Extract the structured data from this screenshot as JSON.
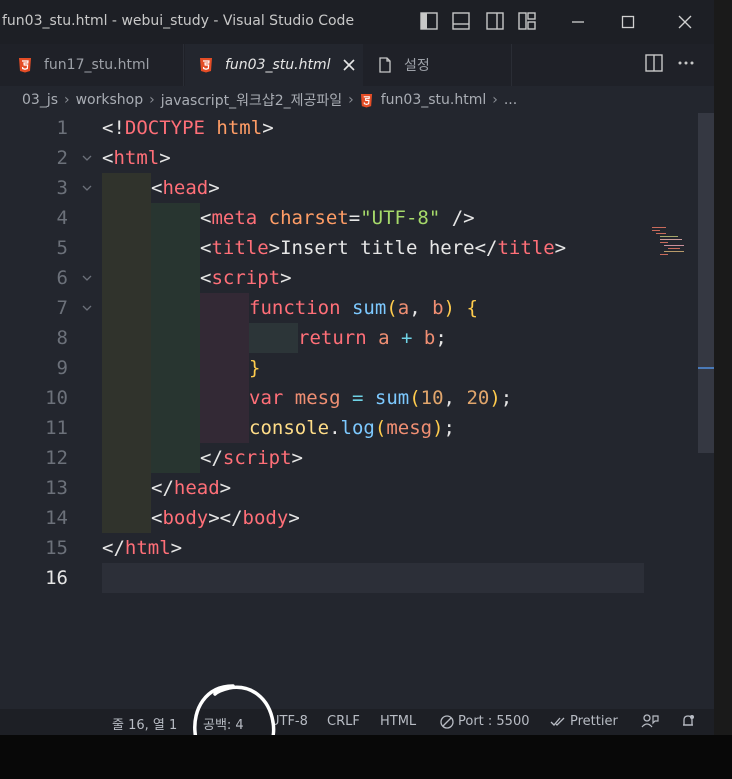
{
  "window": {
    "title": "fun03_stu.html - webui_study - Visual Studio Code"
  },
  "tabs": [
    {
      "label": "fun17_stu.html",
      "icon": "html5-icon"
    },
    {
      "label": "fun03_stu.html",
      "icon": "html5-icon",
      "active": true
    },
    {
      "label": "설정",
      "icon": "file-icon"
    }
  ],
  "breadcrumbs": {
    "items": [
      "03_js",
      "workshop",
      "javascript_워크샵2_제공파일",
      "fun03_stu.html"
    ],
    "ellipsis": "..."
  },
  "editor": {
    "line_numbers": [
      "1",
      "2",
      "3",
      "4",
      "5",
      "6",
      "7",
      "8",
      "9",
      "10",
      "11",
      "12",
      "13",
      "14",
      "15",
      "16"
    ],
    "lines": [
      [
        [
          "<!",
          "c-punct"
        ],
        [
          "DOCTYPE",
          "c-tag"
        ],
        [
          " ",
          "c-text"
        ],
        [
          "html",
          "c-attr"
        ],
        [
          ">",
          "c-punct"
        ]
      ],
      [
        [
          "<",
          "c-punct"
        ],
        [
          "html",
          "c-tag"
        ],
        [
          ">",
          "c-punct"
        ]
      ],
      [
        [
          "<",
          "c-punct"
        ],
        [
          "head",
          "c-tag"
        ],
        [
          ">",
          "c-punct"
        ]
      ],
      [
        [
          "<",
          "c-punct"
        ],
        [
          "meta",
          "c-tag"
        ],
        [
          " ",
          "c-text"
        ],
        [
          "charset",
          "c-attr"
        ],
        [
          "=",
          "c-punct"
        ],
        [
          "\"UTF-8\"",
          "c-str"
        ],
        [
          " />",
          "c-punct"
        ]
      ],
      [
        [
          "<",
          "c-punct"
        ],
        [
          "title",
          "c-tag"
        ],
        [
          ">",
          "c-punct"
        ],
        [
          "Insert title here",
          "c-text"
        ],
        [
          "</",
          "c-punct"
        ],
        [
          "title",
          "c-tag"
        ],
        [
          ">",
          "c-punct"
        ]
      ],
      [
        [
          "<",
          "c-punct"
        ],
        [
          "script",
          "c-tag"
        ],
        [
          ">",
          "c-punct"
        ]
      ],
      [
        [
          "function",
          "c-kw"
        ],
        [
          " ",
          "c-text"
        ],
        [
          "sum",
          "c-fn"
        ],
        [
          "(",
          "c-br"
        ],
        [
          "a",
          "c-var"
        ],
        [
          ", ",
          "c-punct"
        ],
        [
          "b",
          "c-var"
        ],
        [
          ")",
          "c-br"
        ],
        [
          " ",
          "c-text"
        ],
        [
          "{",
          "c-br"
        ]
      ],
      [
        [
          "return",
          "c-kw"
        ],
        [
          " ",
          "c-text"
        ],
        [
          "a",
          "c-var"
        ],
        [
          " + ",
          "c-op"
        ],
        [
          "b",
          "c-var"
        ],
        [
          ";",
          "c-punct"
        ]
      ],
      [
        [
          "}",
          "c-br"
        ]
      ],
      [
        [
          "var",
          "c-kw"
        ],
        [
          " ",
          "c-text"
        ],
        [
          "mesg",
          "c-var"
        ],
        [
          " = ",
          "c-op"
        ],
        [
          "sum",
          "c-fn"
        ],
        [
          "(",
          "c-br"
        ],
        [
          "10",
          "c-num"
        ],
        [
          ", ",
          "c-punct"
        ],
        [
          "20",
          "c-num"
        ],
        [
          ")",
          "c-br"
        ],
        [
          ";",
          "c-punct"
        ]
      ],
      [
        [
          "console",
          "c-obj"
        ],
        [
          ".",
          "c-punct"
        ],
        [
          "log",
          "c-fn"
        ],
        [
          "(",
          "c-br"
        ],
        [
          "mesg",
          "c-var"
        ],
        [
          ")",
          "c-br"
        ],
        [
          ";",
          "c-punct"
        ]
      ],
      [
        [
          "</",
          "c-punct"
        ],
        [
          "script",
          "c-tag"
        ],
        [
          ">",
          "c-punct"
        ]
      ],
      [
        [
          "</",
          "c-punct"
        ],
        [
          "head",
          "c-tag"
        ],
        [
          ">",
          "c-punct"
        ]
      ],
      [
        [
          "<",
          "c-punct"
        ],
        [
          "body",
          "c-tag"
        ],
        [
          "></",
          "c-punct"
        ],
        [
          "body",
          "c-tag"
        ],
        [
          ">",
          "c-punct"
        ]
      ],
      [
        [
          "</",
          "c-punct"
        ],
        [
          "html",
          "c-tag"
        ],
        [
          ">",
          "c-punct"
        ]
      ],
      []
    ]
  },
  "statusbar": {
    "position": "줄 16, 열 1",
    "indent": "공백: 4",
    "encoding": "UTF-8",
    "eol": "CRLF",
    "language": "HTML",
    "port": "Port : 5500",
    "prettier": "Prettier"
  }
}
